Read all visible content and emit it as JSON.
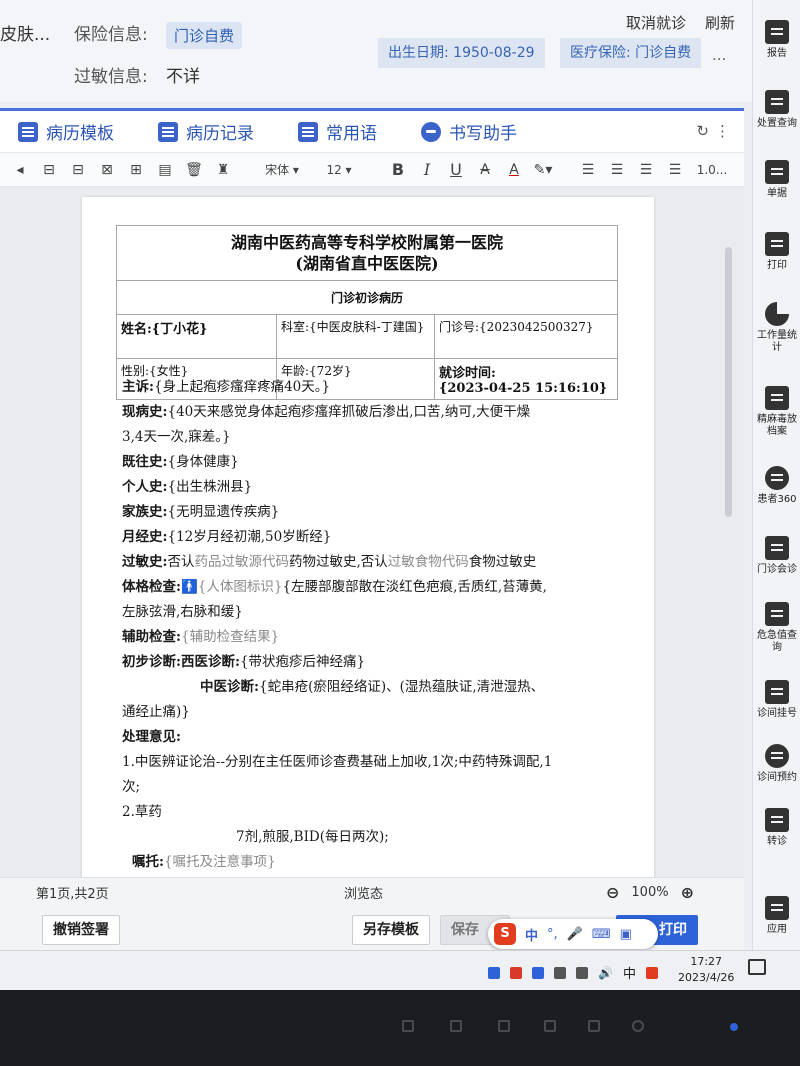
{
  "patient": {
    "dept_fragment": "皮肤...",
    "insurance_label": "保险信息:",
    "insurance_value": "门诊自费",
    "allergy_label": "过敏信息:",
    "allergy_value": "不详",
    "birth": "出生日期: 1950-08-29",
    "med_insurance": "医疗保险: 门诊自费",
    "more": "...",
    "cancel_visit": "取消就诊",
    "refresh": "刷新"
  },
  "tabs": [
    {
      "label": "病历模板",
      "icon": "document-template-icon"
    },
    {
      "label": "病历记录",
      "icon": "list-icon"
    },
    {
      "label": "常用语",
      "icon": "chat-icon"
    },
    {
      "label": "书写助手",
      "icon": "assistant-icon"
    }
  ],
  "toolbar": {
    "font": "宋体",
    "size": "12",
    "bold": "B",
    "italic": "I",
    "underline": "U",
    "strike": "A",
    "color": "A",
    "spacing": "1.0..."
  },
  "document": {
    "hospital_line1": "湖南中医药高等专科学校附属第一医院",
    "hospital_line2": "(湖南省直中医医院)",
    "record_title": "门诊初诊病历",
    "name": "姓名:{丁小花}",
    "dept": "科室:{中医皮肤科-丁建国}",
    "clinic_no": "门诊号:{2023042500327}",
    "gender": "性别:{女性}",
    "age": "年龄:{72岁}",
    "visit_time_label": "就诊时间:",
    "visit_time_value": "{2023-04-25 15:16:10}",
    "chief_label": "主诉:",
    "chief": "{身上起疱疹瘙痒疼痛40天。}",
    "present_label": "现病史:",
    "present_1": "{40天来感觉身体起疱疹瘙痒抓破后渗出,口苦,纳可,大便干燥",
    "present_2": "3,4天一次,寐差。}",
    "past_label": "既往史:",
    "past": "{身体健康}",
    "personal_label": "个人史:",
    "personal": "{出生株洲县}",
    "family_label": "家族史:",
    "family": "{无明显遗传疾病}",
    "menstrual_label": "月经史:",
    "menstrual": "{12岁月经初潮,50岁断经}",
    "allergy_label": "过敏史:",
    "allergy_a": "否认",
    "allergy_b": "药品过敏源代码",
    "allergy_c": "药物过敏史,否认",
    "allergy_d": "过敏食物代码",
    "allergy_e": "食物过敏史",
    "exam_label": "体格检查:",
    "exam_ph": "{人体图标识}",
    "exam_1": "{左腰部腹部散在淡红色疤痕,舌质红,苔薄黄,",
    "exam_2": "左脉弦滑,右脉和缓}",
    "aux_label": "辅助检查:",
    "aux": "{辅助检查结果}",
    "diag_label": "初步诊断:",
    "west_label": "西医诊断:",
    "west": "{带状疱疹后神经痛}",
    "tcm_label": "中医诊断:",
    "tcm_1": "{蛇串疮(瘀阻经络证)、(湿热蕴肤证,清泄湿热、",
    "tcm_2": "通经止痛)}",
    "treat_label": "处理意见:",
    "treat_1": "1.中医辨证论治--分别在主任医师诊查费基础上加收,1次;中药特殊调配,1",
    "treat_2": "次;",
    "treat_3": "2.草药",
    "treat_4": "7剂,煎服,BID(每日两次);",
    "advice_label": "嘱托:",
    "advice": "{嘱托及注意事项}"
  },
  "status": {
    "page": "第1页,共2页",
    "mode": "浏览态",
    "zoom": "100%",
    "zoom_out": "⊖",
    "zoom_in": "⊕"
  },
  "actions": {
    "revoke_sign": "撤销签署",
    "save_template": "另存模板",
    "save": "保存",
    "print": "打印"
  },
  "ime": {
    "logo": "S",
    "lang": "中",
    "punct": "°,"
  },
  "sidebar": [
    {
      "label": "报告",
      "icon": "report-icon"
    },
    {
      "label": "处置查询",
      "icon": "disposal-query-icon"
    },
    {
      "label": "单据",
      "icon": "receipt-icon"
    },
    {
      "label": "打印",
      "icon": "printer-icon"
    },
    {
      "label": "工作量统计",
      "icon": "pie-chart-icon"
    },
    {
      "label": "精麻毒放档案",
      "icon": "archive-icon"
    },
    {
      "label": "患者360",
      "icon": "patient-360-icon"
    },
    {
      "label": "门诊会诊",
      "icon": "consultation-icon"
    },
    {
      "label": "危急值查询",
      "icon": "critical-value-icon"
    },
    {
      "label": "诊间挂号",
      "icon": "registration-icon"
    },
    {
      "label": "诊间预约",
      "icon": "appointment-icon"
    },
    {
      "label": "转诊",
      "icon": "referral-icon"
    },
    {
      "label": "应用",
      "icon": "apps-icon"
    }
  ],
  "taskbar": {
    "time": "17:27",
    "date": "2023/4/26",
    "ime_lang": "中"
  }
}
